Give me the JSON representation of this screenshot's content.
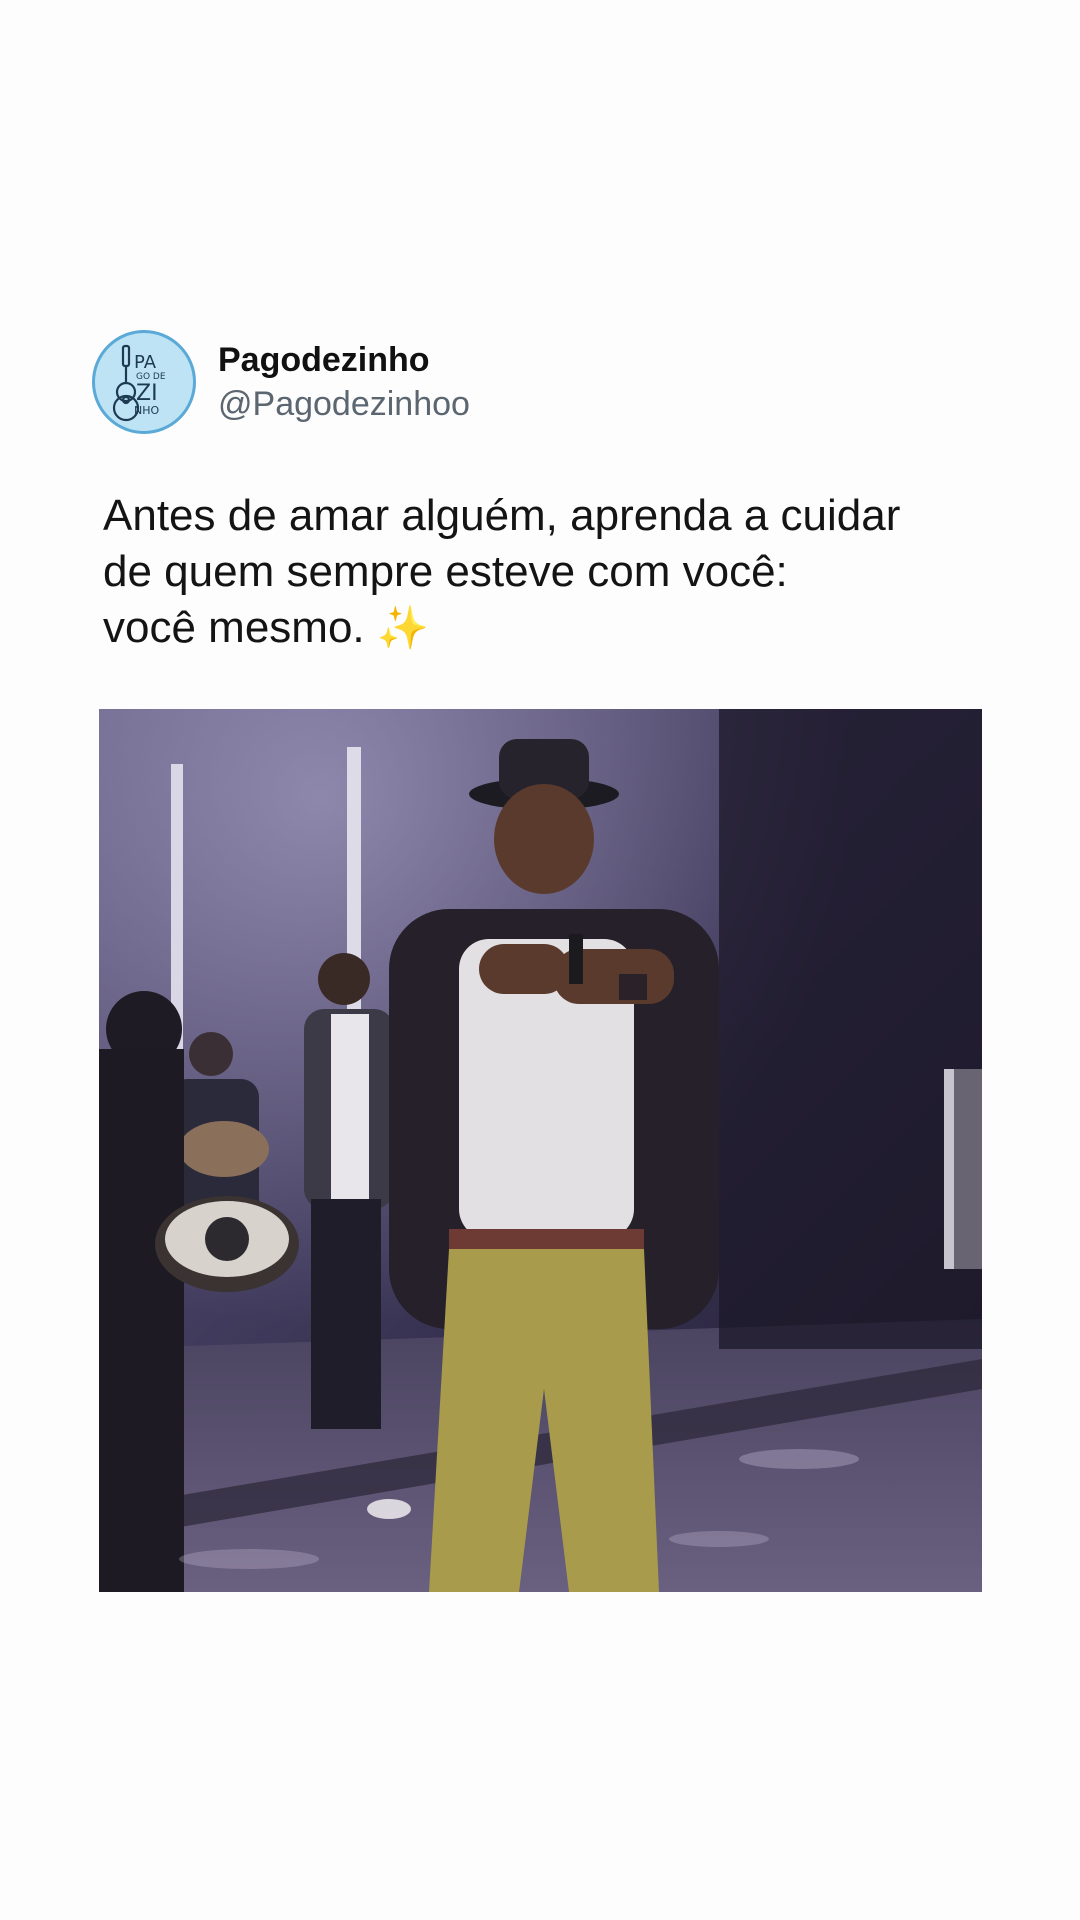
{
  "tweet": {
    "author": {
      "display_name": "Pagodezinho",
      "handle": "@Pagodezinhoo",
      "avatar_icon": "pagodezinho-guitar-logo"
    },
    "text_lines": [
      "Antes de amar alguém, aprenda a cuidar",
      "de quem sempre esteve com você:",
      "você mesmo."
    ],
    "emoji": "✨",
    "media": {
      "type": "video-frame",
      "description_icon": "stage-performance-image"
    }
  },
  "colors": {
    "background": "#fdfdfd",
    "name": "#111111",
    "handle": "#5b6670",
    "avatar_bg": "#bde3f5",
    "avatar_border": "#5aa9d6"
  }
}
